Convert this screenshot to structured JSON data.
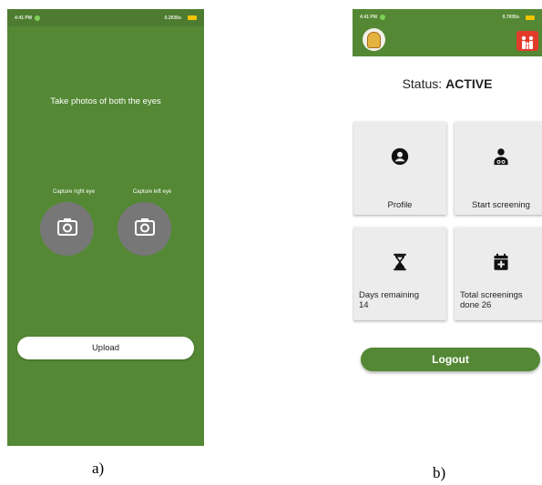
{
  "colors": {
    "brand_green": "#548834",
    "camera_button": "#777777",
    "tile_background": "#ececec"
  },
  "panel_a": {
    "statusbar": {
      "time": "4:41 PM",
      "network": "0.2KB/s"
    },
    "instruction": "Take photos of both the eyes",
    "capture_right_label": "Capture right eye",
    "capture_left_label": "Capture left eye",
    "icons": {
      "capture_right": "camera-icon",
      "capture_left": "camera-icon"
    },
    "upload_label": "Upload",
    "caption": "a)"
  },
  "panel_b": {
    "statusbar": {
      "time": "4:41 PM",
      "network": "0.7KB/s"
    },
    "status_prefix": "Status:",
    "status_value": "ACTIVE",
    "tiles": [
      {
        "label": "Profile",
        "icon": "account-circle-icon"
      },
      {
        "label": "Start screening",
        "icon": "doctor-icon"
      },
      {
        "label_line1": "Days remaining",
        "label_line2": "14",
        "icon": "hourglass-icon"
      },
      {
        "label_line1": "Total screenings",
        "label_line2": "done 26",
        "icon": "calendar-plus-icon"
      }
    ],
    "logout_label": "Logout",
    "caption": "b)"
  }
}
